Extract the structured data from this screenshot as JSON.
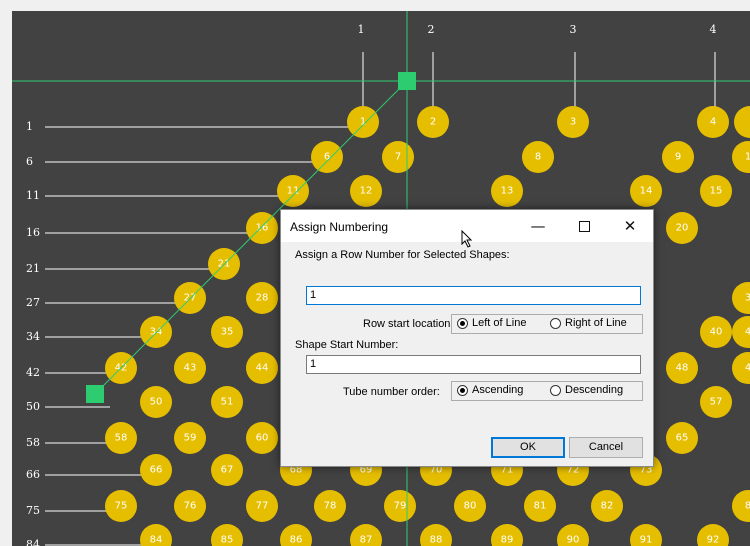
{
  "canvas": {
    "background": "#424242",
    "bubble_color": "#e6be00",
    "guide_color": "#2ecc71",
    "column_labels": [
      "1",
      "2",
      "3",
      "4"
    ],
    "row_labels": [
      "1",
      "6",
      "11",
      "16",
      "21",
      "27",
      "34",
      "42",
      "50",
      "58",
      "66",
      "75",
      "84"
    ],
    "bubbles": [
      {
        "n": "1"
      },
      {
        "n": "2"
      },
      {
        "n": "3"
      },
      {
        "n": "4"
      },
      {
        "n": ""
      },
      {
        "n": "6"
      },
      {
        "n": "7"
      },
      {
        "n": "8"
      },
      {
        "n": "9"
      },
      {
        "n": "1"
      },
      {
        "n": "11"
      },
      {
        "n": "12"
      },
      {
        "n": "13"
      },
      {
        "n": "14"
      },
      {
        "n": "15"
      },
      {
        "n": "16"
      },
      {
        "n": "20"
      },
      {
        "n": "21"
      },
      {
        "n": "27"
      },
      {
        "n": "28"
      },
      {
        "n": "3"
      },
      {
        "n": "34"
      },
      {
        "n": "35"
      },
      {
        "n": "40"
      },
      {
        "n": "4"
      },
      {
        "n": "42"
      },
      {
        "n": "43"
      },
      {
        "n": "44"
      },
      {
        "n": "48"
      },
      {
        "n": "4"
      },
      {
        "n": "50"
      },
      {
        "n": "51"
      },
      {
        "n": "57"
      },
      {
        "n": "58"
      },
      {
        "n": "59"
      },
      {
        "n": "60"
      },
      {
        "n": "65"
      },
      {
        "n": "66"
      },
      {
        "n": "67"
      },
      {
        "n": "68"
      },
      {
        "n": "69"
      },
      {
        "n": "70"
      },
      {
        "n": "71"
      },
      {
        "n": "72"
      },
      {
        "n": "73"
      },
      {
        "n": "75"
      },
      {
        "n": "76"
      },
      {
        "n": "77"
      },
      {
        "n": "78"
      },
      {
        "n": "79"
      },
      {
        "n": "80"
      },
      {
        "n": "81"
      },
      {
        "n": "82"
      },
      {
        "n": "8"
      },
      {
        "n": "84"
      },
      {
        "n": "85"
      },
      {
        "n": "86"
      },
      {
        "n": "87"
      },
      {
        "n": "88"
      },
      {
        "n": "89"
      },
      {
        "n": "90"
      },
      {
        "n": "91"
      },
      {
        "n": "92"
      }
    ]
  },
  "dialog": {
    "title": "Assign Numbering",
    "minimize_glyph": "—",
    "close_glyph": "✕",
    "row_number_label": "Assign a Row Number for Selected Shapes:",
    "row_number_value": "1",
    "row_start_label": "Row start location:",
    "row_start_options": [
      "Left of Line",
      "Right of Line"
    ],
    "row_start_selected": "Left of Line",
    "start_number_label": "Shape Start Number:",
    "start_number_value": "1",
    "tube_order_label": "Tube number order:",
    "tube_order_options": [
      "Ascending",
      "Descending"
    ],
    "tube_order_selected": "Ascending",
    "ok_label": "OK",
    "cancel_label": "Cancel"
  }
}
